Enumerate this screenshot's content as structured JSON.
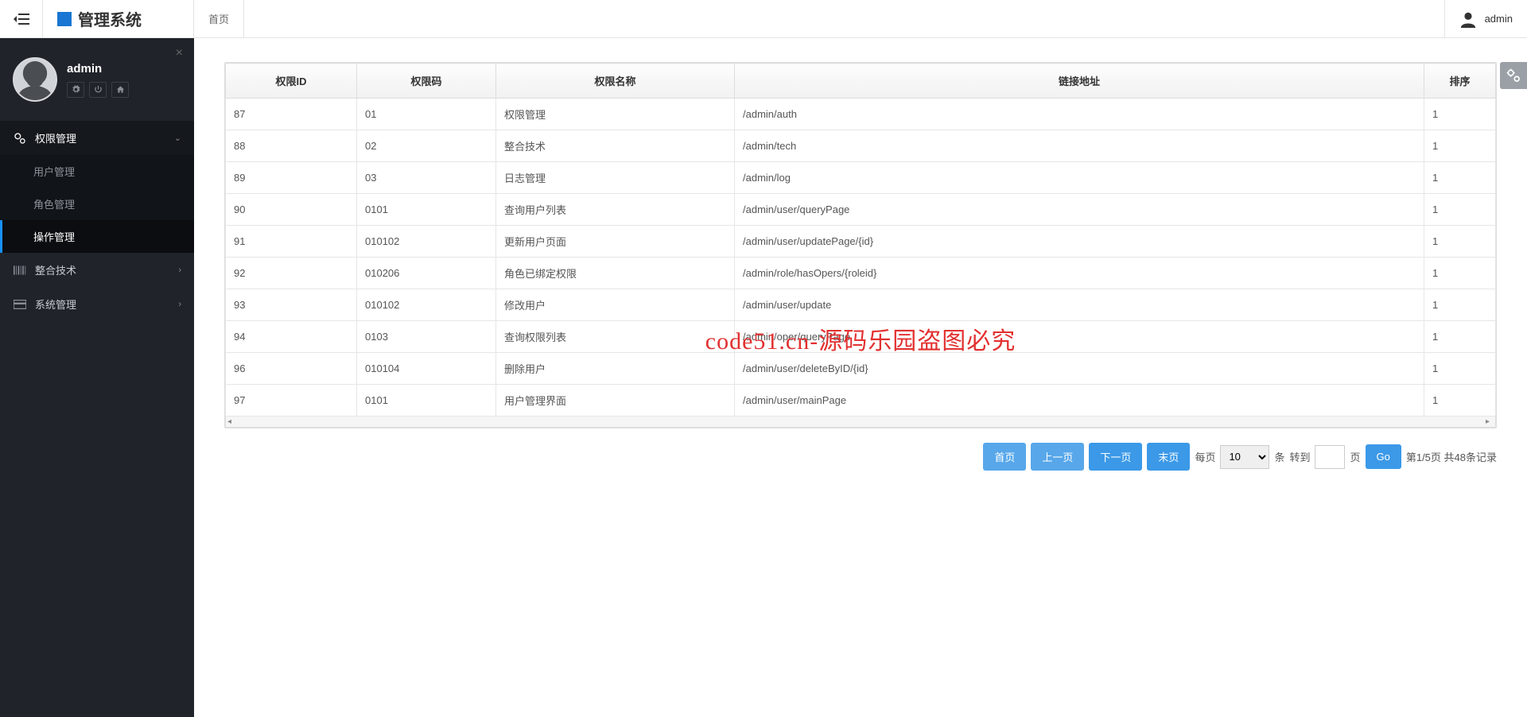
{
  "brand": {
    "title": "管理系统"
  },
  "topbar": {
    "tab_home": "首页",
    "username": "admin"
  },
  "sidebar": {
    "username": "admin",
    "nav": {
      "perm": "权限管理",
      "perm_sub": [
        "用户管理",
        "角色管理",
        "操作管理"
      ],
      "tech": "整合技术",
      "sys": "系统管理"
    }
  },
  "table": {
    "headers": {
      "id": "权限ID",
      "code": "权限码",
      "name": "权限名称",
      "url": "链接地址",
      "sort": "排序"
    },
    "rows": [
      {
        "id": "87",
        "code": "01",
        "name": "权限管理",
        "url": "/admin/auth",
        "sort": "1"
      },
      {
        "id": "88",
        "code": "02",
        "name": "整合技术",
        "url": "/admin/tech",
        "sort": "1"
      },
      {
        "id": "89",
        "code": "03",
        "name": "日志管理",
        "url": "/admin/log",
        "sort": "1"
      },
      {
        "id": "90",
        "code": "0101",
        "name": "查询用户列表",
        "url": "/admin/user/queryPage",
        "sort": "1"
      },
      {
        "id": "91",
        "code": "010102",
        "name": "更新用户页面",
        "url": "/admin/user/updatePage/{id}",
        "sort": "1"
      },
      {
        "id": "92",
        "code": "010206",
        "name": "角色已绑定权限",
        "url": "/admin/role/hasOpers/{roleid}",
        "sort": "1"
      },
      {
        "id": "93",
        "code": "010102",
        "name": "修改用户",
        "url": "/admin/user/update",
        "sort": "1"
      },
      {
        "id": "94",
        "code": "0103",
        "name": "查询权限列表",
        "url": "/admin/oper/queryPage",
        "sort": "1"
      },
      {
        "id": "96",
        "code": "010104",
        "name": "删除用户",
        "url": "/admin/user/deleteByID/{id}",
        "sort": "1"
      },
      {
        "id": "97",
        "code": "0101",
        "name": "用户管理界面",
        "url": "/admin/user/mainPage",
        "sort": "1"
      }
    ]
  },
  "pager": {
    "first": "首页",
    "prev": "上一页",
    "next": "下一页",
    "last": "末页",
    "per_label_pre": "每页",
    "per_value": "10",
    "per_label_suf": "条",
    "goto_pre": "转到",
    "goto_suf": "页",
    "go": "Go",
    "summary": "第1/5页 共48条记录"
  },
  "watermark": "code51.cn-源码乐园盗图必究"
}
